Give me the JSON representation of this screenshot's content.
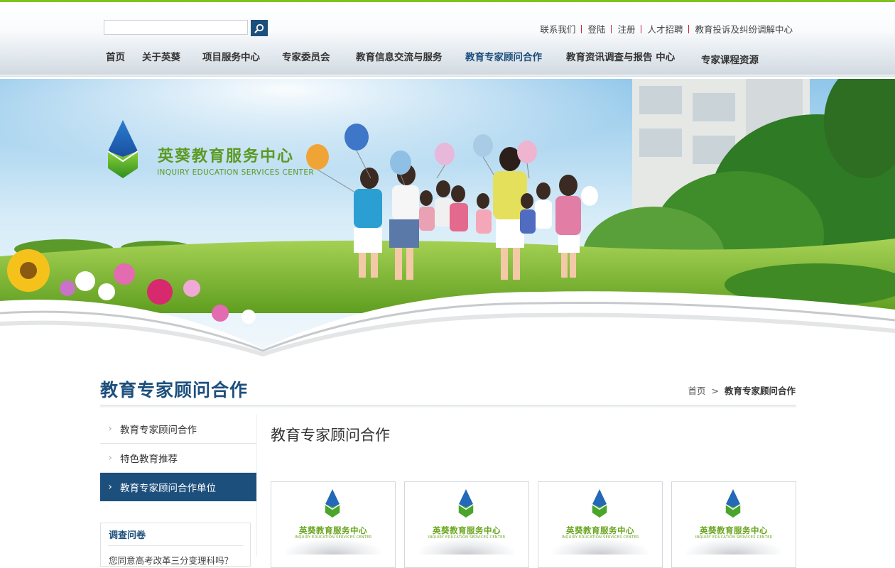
{
  "search": {
    "placeholder": "",
    "button_icon": "search-icon"
  },
  "top_links": [
    "联系我们",
    "登陆",
    "注册",
    "人才招聘",
    "教育投诉及纠纷调解中心"
  ],
  "nav": {
    "items": [
      "首页",
      "关于英葵",
      "项目服务中心",
      "专家委员会",
      "教育信息交流与服务",
      "教育专家顾问合作",
      "教育资讯调查与报告 中心",
      "专家课程资源"
    ],
    "active": "教育专家顾问合作"
  },
  "banner": {
    "logo_cn": "英葵教育服务中心",
    "logo_en": "INQUIRY EDUCATION SERVICES CENTER"
  },
  "page": {
    "title": "教育专家顾问合作",
    "breadcrumb": {
      "home": "首页",
      "separator": ">",
      "current": "教育专家顾问合作"
    }
  },
  "sidebar": {
    "items": [
      {
        "label": "教育专家顾问合作",
        "active": false
      },
      {
        "label": "特色教育推荐",
        "active": false
      },
      {
        "label": "教育专家顾问合作单位",
        "active": true
      }
    ]
  },
  "survey": {
    "title": "调查问卷",
    "text": "您同意高考改革三分变理科吗？"
  },
  "content": {
    "title": "教育专家顾问合作",
    "cards": [
      {
        "cn": "英葵教育服务中心",
        "en": "INQUIRY EDUCATION SERVICES CENTER"
      },
      {
        "cn": "英葵教育服务中心",
        "en": "INQUIRY EDUCATION SERVICES CENTER"
      },
      {
        "cn": "英葵教育服务中心",
        "en": "INQUIRY EDUCATION SERVICES CENTER"
      },
      {
        "cn": "英葵教育服务中心",
        "en": "INQUIRY EDUCATION SERVICES CENTER"
      }
    ]
  },
  "colors": {
    "brand_blue": "#1d4f7d",
    "brand_green": "#7fc31c",
    "logo_green": "#69a51f"
  }
}
